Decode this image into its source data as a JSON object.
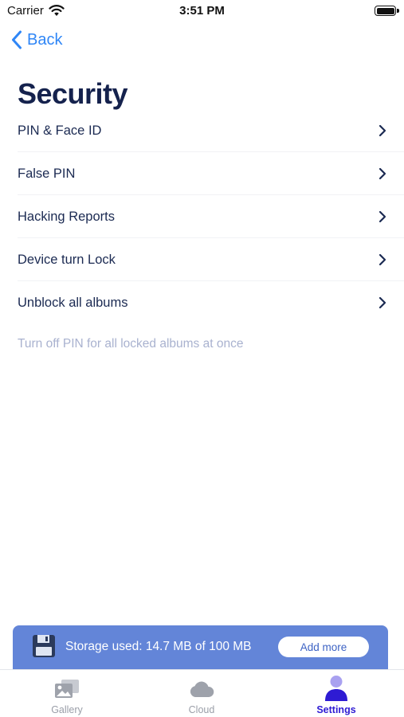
{
  "status_bar": {
    "carrier": "Carrier",
    "time": "3:51 PM"
  },
  "nav": {
    "back_label": "Back"
  },
  "title": "Security",
  "menu": {
    "items": [
      {
        "label": "PIN & Face ID"
      },
      {
        "label": "False PIN"
      },
      {
        "label": "Hacking Reports"
      },
      {
        "label": "Device turn Lock"
      },
      {
        "label": "Unblock all albums"
      }
    ]
  },
  "hint": "Turn off PIN for all locked albums at once",
  "storage": {
    "text": "Storage used: 14.7 MB of 100 MB",
    "button_label": "Add more",
    "icon": "floppy-disk-icon"
  },
  "tabs": [
    {
      "label": "Gallery",
      "icon": "gallery-icon",
      "active": false
    },
    {
      "label": "Cloud",
      "icon": "cloud-icon",
      "active": false
    },
    {
      "label": "Settings",
      "icon": "user-icon",
      "active": true
    }
  ],
  "colors": {
    "accent": "#2f86f6",
    "title": "#15224d",
    "banner": "#6385d8",
    "active_tab": "#2e1bd3",
    "hint": "#a9b2cf"
  }
}
